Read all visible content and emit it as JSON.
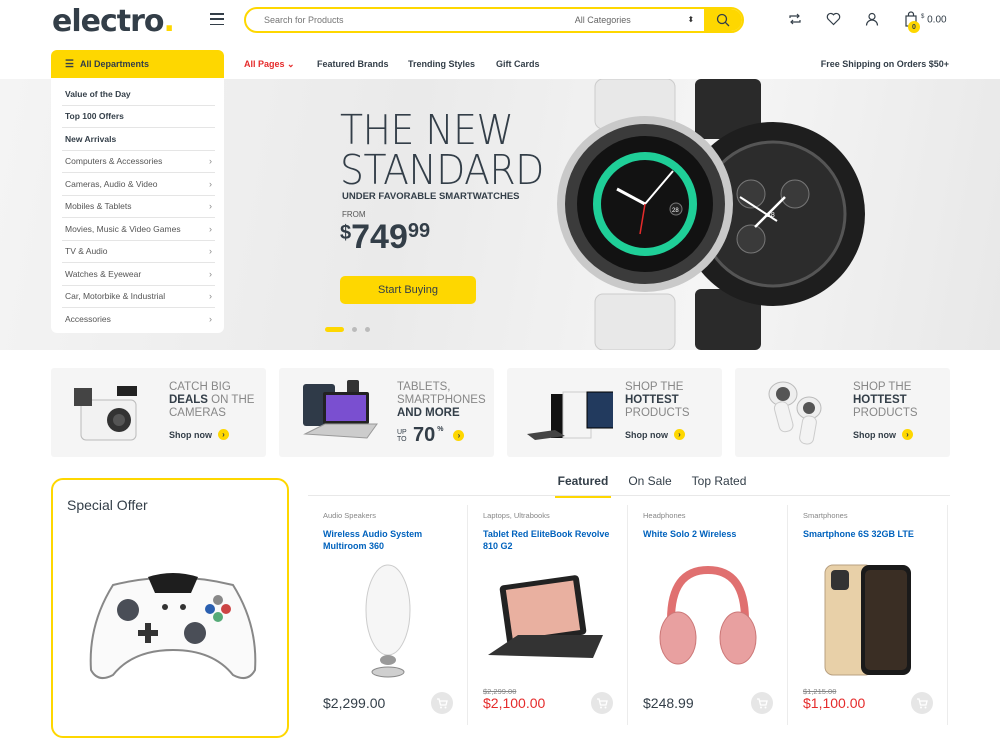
{
  "header": {
    "logo_text": "electro",
    "logo_dot": ".",
    "search_placeholder": "Search for Products",
    "category_select": "All Categories",
    "cart_badge": "0",
    "cart_currency": "$",
    "cart_total": "0.00",
    "icons": [
      "menu-icon",
      "search-icon",
      "compare-icon",
      "heart-icon",
      "user-icon",
      "shopping-bag-icon"
    ]
  },
  "nav": {
    "departments_label": "All Departments",
    "links": [
      {
        "label": "All Pages",
        "active": true
      },
      {
        "label": "Featured Brands"
      },
      {
        "label": "Trending Styles"
      },
      {
        "label": "Gift Cards"
      }
    ],
    "free_shipping": "Free Shipping on Orders $50+"
  },
  "sidebar": {
    "items": [
      {
        "label": "Value of the Day",
        "bold": true
      },
      {
        "label": "Top 100 Offers",
        "bold": true
      },
      {
        "label": "New Arrivals",
        "bold": true
      },
      {
        "label": "Computers & Accessories"
      },
      {
        "label": "Cameras, Audio & Video"
      },
      {
        "label": "Mobiles & Tablets"
      },
      {
        "label": "Movies, Music & Video Games"
      },
      {
        "label": "TV & Audio"
      },
      {
        "label": "Watches & Eyewear"
      },
      {
        "label": "Car, Motorbike & Industrial"
      },
      {
        "label": "Accessories"
      }
    ]
  },
  "hero": {
    "title_line1": "THE NEW",
    "title_line2": "STANDARD",
    "subtitle": "UNDER FAVORABLE SMARTWATCHES",
    "from_label": "FROM",
    "price_currency": "$",
    "price_whole": "749",
    "price_cents": "99",
    "button_label": "Start Buying",
    "slides": 3,
    "active_slide": 1,
    "watch_date_1": "28",
    "watch_date_2": "28"
  },
  "banners": [
    {
      "pre": "CATCH BIG ",
      "bold": "DEALS",
      "post": " ON THE CAMERAS",
      "cta": "Shop now"
    },
    {
      "pre": "TABLETS, SMARTPHONES ",
      "bold": "AND MORE",
      "post": "",
      "upto": "UP TO",
      "discount": "70",
      "percent": "%"
    },
    {
      "pre": "SHOP THE ",
      "bold": "HOTTEST",
      "post": " PRODUCTS",
      "cta": "Shop now"
    },
    {
      "pre": "SHOP THE ",
      "bold": "HOTTEST",
      "post": " PRODUCTS",
      "cta": "Shop now"
    }
  ],
  "special_offer": {
    "title": "Special Offer"
  },
  "tabs": [
    {
      "label": "Featured",
      "active": true
    },
    {
      "label": "On Sale"
    },
    {
      "label": "Top Rated"
    }
  ],
  "products": [
    {
      "category": "Audio Speakers",
      "name": "Wireless Audio System Multiroom 360",
      "old_price": "",
      "price": "$2,299.00",
      "sale": false
    },
    {
      "category": "Laptops, Ultrabooks",
      "name": "Tablet Red EliteBook Revolve 810 G2",
      "old_price": "$2,299.00",
      "price": "$2,100.00",
      "sale": true
    },
    {
      "category": "Headphones",
      "name": "White Solo 2 Wireless",
      "old_price": "",
      "price": "$248.99",
      "sale": false
    },
    {
      "category": "Smartphones",
      "name": "Smartphone 6S 32GB LTE",
      "old_price": "$1,215.00",
      "price": "$1,100.00",
      "sale": true
    }
  ],
  "colors": {
    "accent": "#fed700",
    "text": "#333e48",
    "link": "#0062bd",
    "sale": "#e52b2b"
  }
}
